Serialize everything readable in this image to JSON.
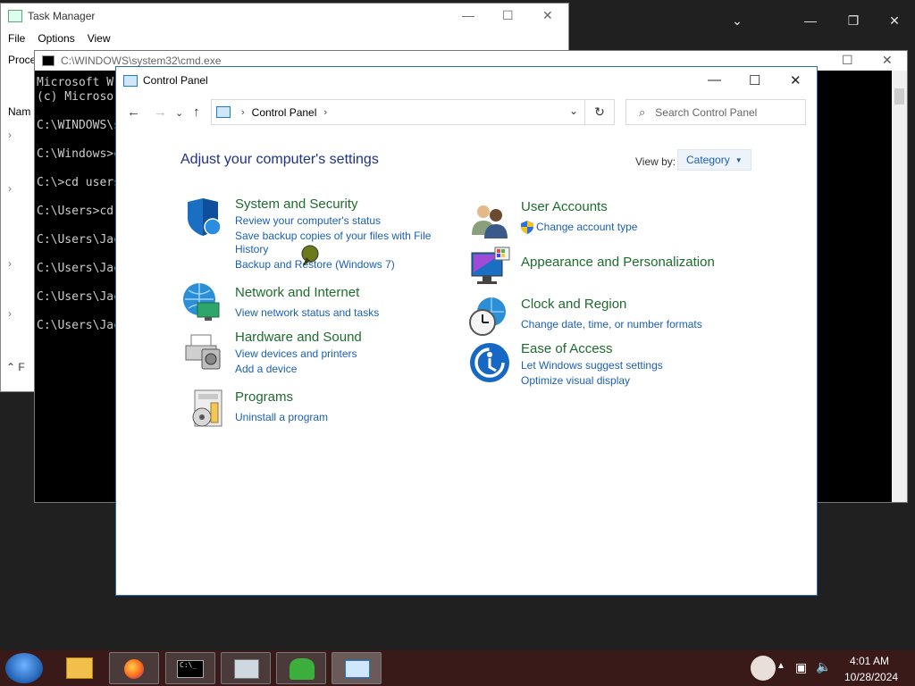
{
  "host": {
    "icons": [
      "chevron-down-icon",
      "minimize-icon",
      "restore-icon",
      "close-icon"
    ]
  },
  "task_manager": {
    "title": "Task Manager",
    "menu": [
      "File",
      "Options",
      "View"
    ],
    "tab_partial": "Proce",
    "name_partial": "Nam",
    "footer_partial": "F"
  },
  "cmd": {
    "title": "C:\\WINDOWS\\system32\\cmd.exe",
    "lines": [
      "Microsoft W",
      "(c) Microso",
      "",
      "C:\\WINDOWS\\s",
      "",
      "C:\\Windows>c",
      "",
      "C:\\>cd users",
      "",
      "C:\\Users>cd",
      "",
      "C:\\Users\\Jac",
      "",
      "C:\\Users\\Jac",
      "",
      "C:\\Users\\Jac",
      "",
      "C:\\Users\\Jac"
    ]
  },
  "control_panel": {
    "title": "Control Panel",
    "breadcrumb": "Control Panel",
    "search_placeholder": "Search Control Panel",
    "heading": "Adjust your computer's settings",
    "view_by_label": "View by:",
    "view_by_value": "Category",
    "categories": [
      {
        "title": "System and Security",
        "links": [
          "Review your computer's status",
          "Save backup copies of your files with File",
          "History",
          "Backup and Restore (Windows 7)"
        ],
        "icon": "shield-icon"
      },
      {
        "title": "Network and Internet",
        "links": [
          "View network status and tasks"
        ],
        "icon": "network-icon"
      },
      {
        "title": "Hardware and Sound",
        "links": [
          "View devices and printers",
          "Add a device"
        ],
        "icon": "printer-icon"
      },
      {
        "title": "Programs",
        "links": [
          "Uninstall a program"
        ],
        "icon": "programs-icon"
      },
      {
        "title": "User Accounts",
        "links": [
          "Change account type"
        ],
        "icon": "users-icon"
      },
      {
        "title": "Appearance and Personalization",
        "links": [],
        "icon": "monitor-icon"
      },
      {
        "title": "Clock and Region",
        "links": [
          "Change date, time, or number formats"
        ],
        "icon": "clock-icon"
      },
      {
        "title": "Ease of Access",
        "links": [
          "Let Windows suggest settings",
          "Optimize visual display"
        ],
        "icon": "ease-of-access-icon"
      }
    ]
  },
  "taskbar": {
    "time": "4:01 AM",
    "date": "10/28/2024"
  }
}
